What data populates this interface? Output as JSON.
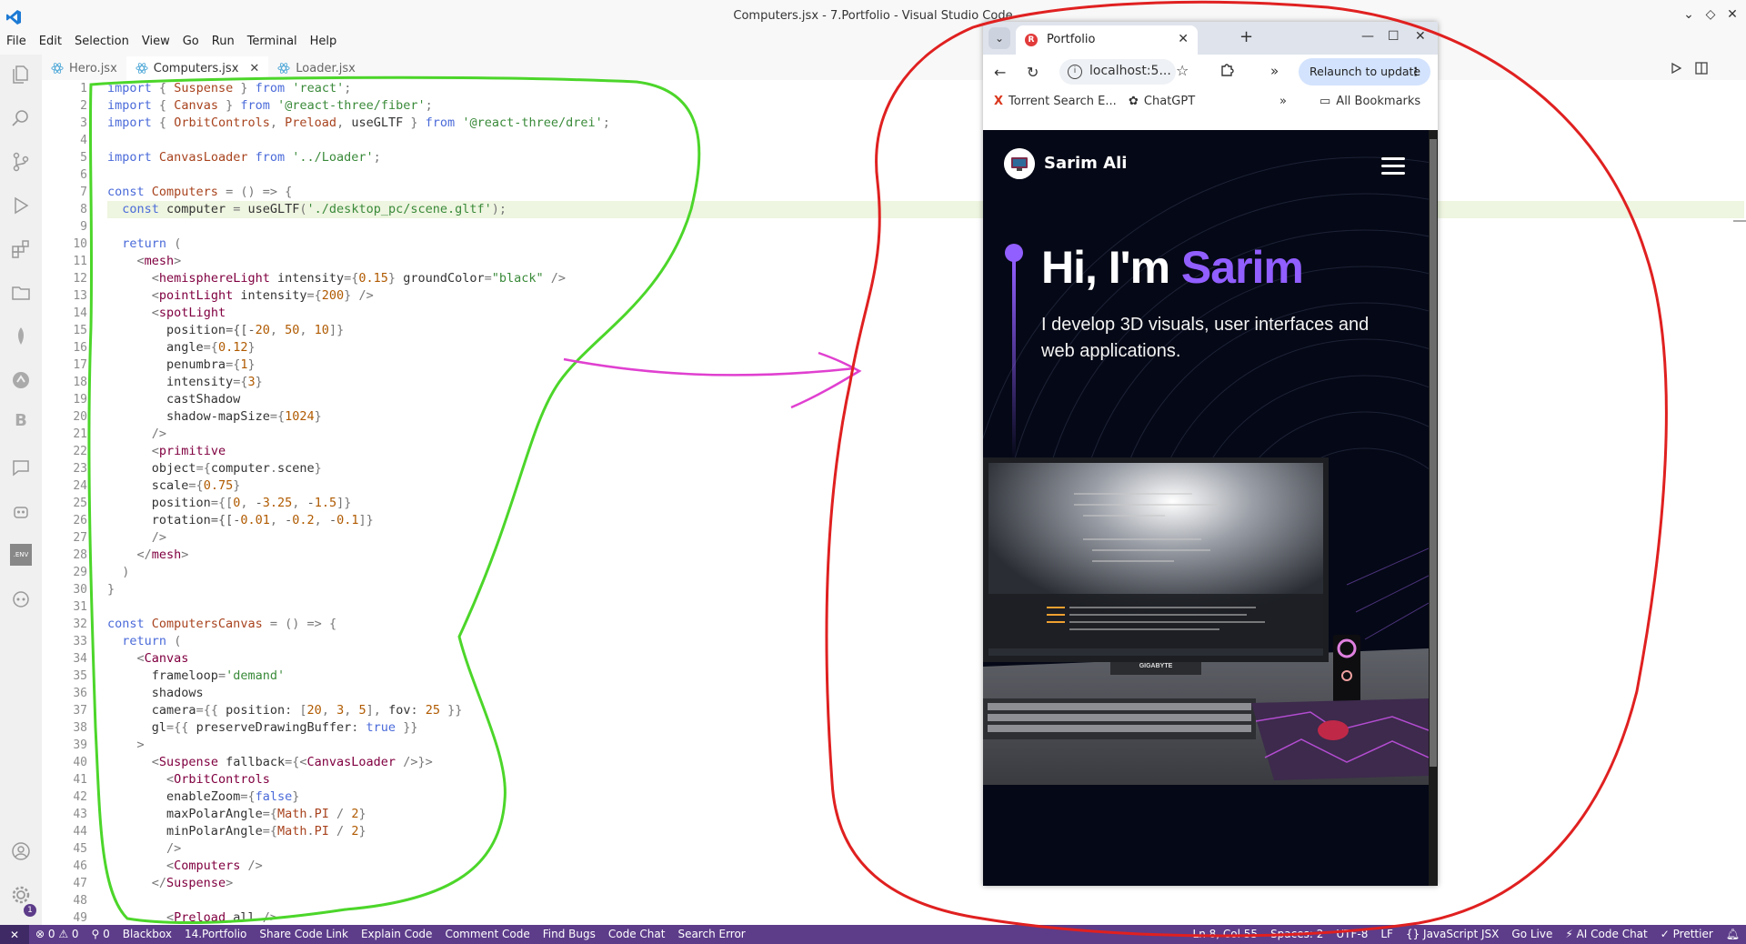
{
  "window": {
    "title": "Computers.jsx - 7.Portfolio - Visual Studio Code"
  },
  "menu": [
    "File",
    "Edit",
    "Selection",
    "View",
    "Go",
    "Run",
    "Terminal",
    "Help"
  ],
  "tabs": [
    {
      "label": "Hero.jsx",
      "active": false
    },
    {
      "label": "Computers.jsx",
      "active": true
    },
    {
      "label": "Loader.jsx",
      "active": false
    }
  ],
  "code_lines": [
    {
      "n": "1",
      "text": "import { Suspense } from 'react';"
    },
    {
      "n": "2",
      "text": "import { Canvas } from '@react-three/fiber';"
    },
    {
      "n": "3",
      "text": "import { OrbitControls, Preload, useGLTF } from '@react-three/drei';"
    },
    {
      "n": "4",
      "text": ""
    },
    {
      "n": "5",
      "text": "import CanvasLoader from '../Loader';"
    },
    {
      "n": "6",
      "text": ""
    },
    {
      "n": "7",
      "text": "const Computers = () => {"
    },
    {
      "n": "8",
      "text": "  const computer = useGLTF('./desktop_pc/scene.gltf');"
    },
    {
      "n": "9",
      "text": ""
    },
    {
      "n": "10",
      "text": "  return ("
    },
    {
      "n": "11",
      "text": "    <mesh>"
    },
    {
      "n": "12",
      "text": "      <hemisphereLight intensity={0.15} groundColor=\"black\" />"
    },
    {
      "n": "13",
      "text": "      <pointLight intensity={200} />"
    },
    {
      "n": "14",
      "text": "      <spotLight"
    },
    {
      "n": "15",
      "text": "        position={[-20, 50, 10]}"
    },
    {
      "n": "16",
      "text": "        angle={0.12}"
    },
    {
      "n": "17",
      "text": "        penumbra={1}"
    },
    {
      "n": "18",
      "text": "        intensity={3}"
    },
    {
      "n": "19",
      "text": "        castShadow"
    },
    {
      "n": "20",
      "text": "        shadow-mapSize={1024}"
    },
    {
      "n": "21",
      "text": "      />"
    },
    {
      "n": "22",
      "text": "      <primitive"
    },
    {
      "n": "23",
      "text": "      object={computer.scene}"
    },
    {
      "n": "24",
      "text": "      scale={0.75}"
    },
    {
      "n": "25",
      "text": "      position={[0, -3.25, -1.5]}"
    },
    {
      "n": "26",
      "text": "      rotation={[-0.01, -0.2, -0.1]}"
    },
    {
      "n": "27",
      "text": "      />"
    },
    {
      "n": "28",
      "text": "    </mesh>"
    },
    {
      "n": "29",
      "text": "  )"
    },
    {
      "n": "30",
      "text": "}"
    },
    {
      "n": "31",
      "text": ""
    },
    {
      "n": "32",
      "text": "const ComputersCanvas = () => {"
    },
    {
      "n": "33",
      "text": "  return ("
    },
    {
      "n": "34",
      "text": "    <Canvas"
    },
    {
      "n": "35",
      "text": "      frameloop='demand'"
    },
    {
      "n": "36",
      "text": "      shadows"
    },
    {
      "n": "37",
      "text": "      camera={{ position: [20, 3, 5], fov: 25 }}"
    },
    {
      "n": "38",
      "text": "      gl={{ preserveDrawingBuffer: true }}"
    },
    {
      "n": "39",
      "text": "    >"
    },
    {
      "n": "40",
      "text": "      <Suspense fallback={<CanvasLoader />}>"
    },
    {
      "n": "41",
      "text": "        <OrbitControls"
    },
    {
      "n": "42",
      "text": "        enableZoom={false}"
    },
    {
      "n": "43",
      "text": "        maxPolarAngle={Math.PI / 2}"
    },
    {
      "n": "44",
      "text": "        minPolarAngle={Math.PI / 2}"
    },
    {
      "n": "45",
      "text": "        />"
    },
    {
      "n": "46",
      "text": "        <Computers />"
    },
    {
      "n": "47",
      "text": "      </Suspense>"
    },
    {
      "n": "48",
      "text": ""
    },
    {
      "n": "49",
      "text": "        <Preload all />"
    }
  ],
  "statusbar": {
    "left": [
      "⊗ 0 ⚠ 0",
      "⚲ 0",
      "Blackbox",
      "14.Portfolio",
      "Share Code Link",
      "Explain Code",
      "Comment Code",
      "Find Bugs",
      "Code Chat",
      "Search Error"
    ],
    "right": [
      "Ln 8, Col 55",
      "Spaces: 2",
      "UTF-8",
      "LF",
      "{} JavaScript JSX",
      "Go Live",
      "⚡ AI Code Chat",
      "✓ Prettier"
    ],
    "notification_count": "1"
  },
  "browser": {
    "tab_title": "Portfolio",
    "url": "localhost:5...",
    "relaunch_label": "Relaunch to update",
    "bookmarks": [
      "Torrent Search E...",
      "ChatGPT",
      "All Bookmarks"
    ],
    "page": {
      "brand": "Sarim Ali",
      "greeting_prefix": "Hi, I'm ",
      "greeting_name": "Sarim",
      "subtitle": "I develop 3D visuals, user interfaces and web applications.",
      "monitor_brand": "GIGABYTE"
    }
  },
  "colors": {
    "statusbar": "#5d3c8a",
    "accent_purple": "#915eff",
    "page_bg": "#050816",
    "annotation_green": "#4cd62a",
    "annotation_red": "#e02020",
    "annotation_magenta": "#e040d0"
  }
}
